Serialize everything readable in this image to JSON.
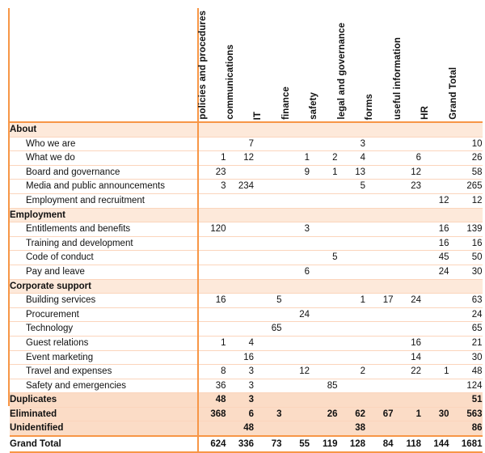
{
  "table": {
    "row_label_header": "",
    "columns": [
      "policies and procedures",
      "communications",
      "IT",
      "finance",
      "safety",
      "legal and governance",
      "forms",
      "useful information",
      "HR",
      "Grand Total"
    ],
    "rows": [
      {
        "label": "About",
        "kind": "group",
        "values": [
          "",
          "",
          "",
          "",
          "",
          "",
          "",
          "",
          "",
          ""
        ]
      },
      {
        "label": "Who we are",
        "kind": "item",
        "values": [
          "",
          "7",
          "",
          "",
          "",
          "3",
          "",
          "",
          "",
          "10"
        ]
      },
      {
        "label": "What we do",
        "kind": "item",
        "values": [
          "1",
          "12",
          "",
          "1",
          "2",
          "4",
          "",
          "6",
          "",
          "26"
        ]
      },
      {
        "label": "Board and governance",
        "kind": "item",
        "values": [
          "23",
          "",
          "",
          "9",
          "1",
          "13",
          "",
          "12",
          "",
          "58"
        ]
      },
      {
        "label": "Media and public announcements",
        "kind": "item",
        "values": [
          "3",
          "234",
          "",
          "",
          "",
          "5",
          "",
          "23",
          "",
          "265"
        ]
      },
      {
        "label": "Employment and recruitment",
        "kind": "item",
        "values": [
          "",
          "",
          "",
          "",
          "",
          "",
          "",
          "",
          "12",
          "12"
        ]
      },
      {
        "label": "Employment",
        "kind": "group",
        "values": [
          "",
          "",
          "",
          "",
          "",
          "",
          "",
          "",
          "",
          ""
        ]
      },
      {
        "label": "Entitlements and benefits",
        "kind": "item",
        "values": [
          "120",
          "",
          "",
          "3",
          "",
          "",
          "",
          "",
          "16",
          "139"
        ]
      },
      {
        "label": "Training and development",
        "kind": "item",
        "values": [
          "",
          "",
          "",
          "",
          "",
          "",
          "",
          "",
          "16",
          "16"
        ]
      },
      {
        "label": "Code of conduct",
        "kind": "item",
        "values": [
          "",
          "",
          "",
          "",
          "5",
          "",
          "",
          "",
          "45",
          "50"
        ]
      },
      {
        "label": "Pay and leave",
        "kind": "item",
        "values": [
          "",
          "",
          "",
          "6",
          "",
          "",
          "",
          "",
          "24",
          "30"
        ]
      },
      {
        "label": "Corporate support",
        "kind": "group",
        "values": [
          "",
          "",
          "",
          "",
          "",
          "",
          "",
          "",
          "",
          ""
        ]
      },
      {
        "label": "Building services",
        "kind": "item",
        "values": [
          "16",
          "",
          "5",
          "",
          "",
          "1",
          "17",
          "24",
          "",
          "63"
        ]
      },
      {
        "label": "Procurement",
        "kind": "item",
        "values": [
          "",
          "",
          "",
          "24",
          "",
          "",
          "",
          "",
          "",
          "24"
        ]
      },
      {
        "label": "Technology",
        "kind": "item",
        "values": [
          "",
          "",
          "65",
          "",
          "",
          "",
          "",
          "",
          "",
          "65"
        ]
      },
      {
        "label": "Guest relations",
        "kind": "item",
        "values": [
          "1",
          "4",
          "",
          "",
          "",
          "",
          "",
          "16",
          "",
          "21"
        ]
      },
      {
        "label": "Event marketing",
        "kind": "item",
        "values": [
          "",
          "16",
          "",
          "",
          "",
          "",
          "",
          "14",
          "",
          "30"
        ]
      },
      {
        "label": "Travel and expenses",
        "kind": "item",
        "values": [
          "8",
          "3",
          "",
          "12",
          "",
          "2",
          "",
          "22",
          "1",
          "48"
        ]
      },
      {
        "label": "Safety and emergencies",
        "kind": "item",
        "values": [
          "36",
          "3",
          "",
          "",
          "85",
          "",
          "",
          "",
          "",
          "124"
        ]
      },
      {
        "label": "Duplicates",
        "kind": "summary",
        "values": [
          "48",
          "3",
          "",
          "",
          "",
          "",
          "",
          "",
          "",
          "51"
        ]
      },
      {
        "label": "Eliminated",
        "kind": "summary",
        "values": [
          "368",
          "6",
          "3",
          "",
          "26",
          "62",
          "67",
          "1",
          "30",
          "563"
        ]
      },
      {
        "label": "Unidentified",
        "kind": "summary",
        "values": [
          "",
          "48",
          "",
          "",
          "",
          "38",
          "",
          "",
          "",
          "86"
        ]
      },
      {
        "label": "Grand Total",
        "kind": "grand",
        "values": [
          "624",
          "336",
          "73",
          "55",
          "119",
          "128",
          "84",
          "118",
          "144",
          "1681"
        ]
      }
    ]
  },
  "colors": {
    "accent": "#F79646",
    "group_band": "#FDE9DA",
    "summary_band": "#FBDCC6",
    "row_rule": "#FBD5BC",
    "text": "#111111"
  }
}
